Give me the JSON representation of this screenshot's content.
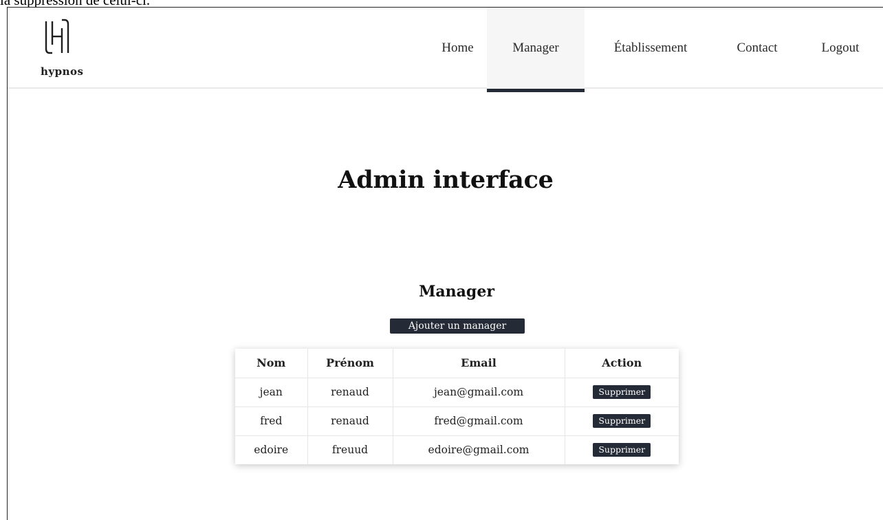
{
  "caption": "la suppression de celui-ci.",
  "brand": {
    "name": "hypnos",
    "logo_letter": "H"
  },
  "nav": {
    "items": [
      "Home",
      "Manager",
      "Établissement",
      "Contact",
      "Logout"
    ],
    "active": "Manager"
  },
  "main": {
    "title": "Admin interface",
    "section_title": "Manager",
    "add_button": "Ajouter un manager"
  },
  "table": {
    "headers": [
      "Nom",
      "Prénom",
      "Email",
      "Action"
    ],
    "rows": [
      {
        "nom": "jean",
        "prenom": "renaud",
        "email": "jean@gmail.com",
        "action": "Supprimer"
      },
      {
        "nom": "fred",
        "prenom": "renaud",
        "email": "fred@gmail.com",
        "action": "Supprimer"
      },
      {
        "nom": "edoire",
        "prenom": "freuud",
        "email": "edoire@gmail.com",
        "action": "Supprimer"
      }
    ]
  },
  "colors": {
    "dark": "#242a36",
    "nav_active_bg": "#f6f6f6",
    "border": "#e6e6e6"
  }
}
